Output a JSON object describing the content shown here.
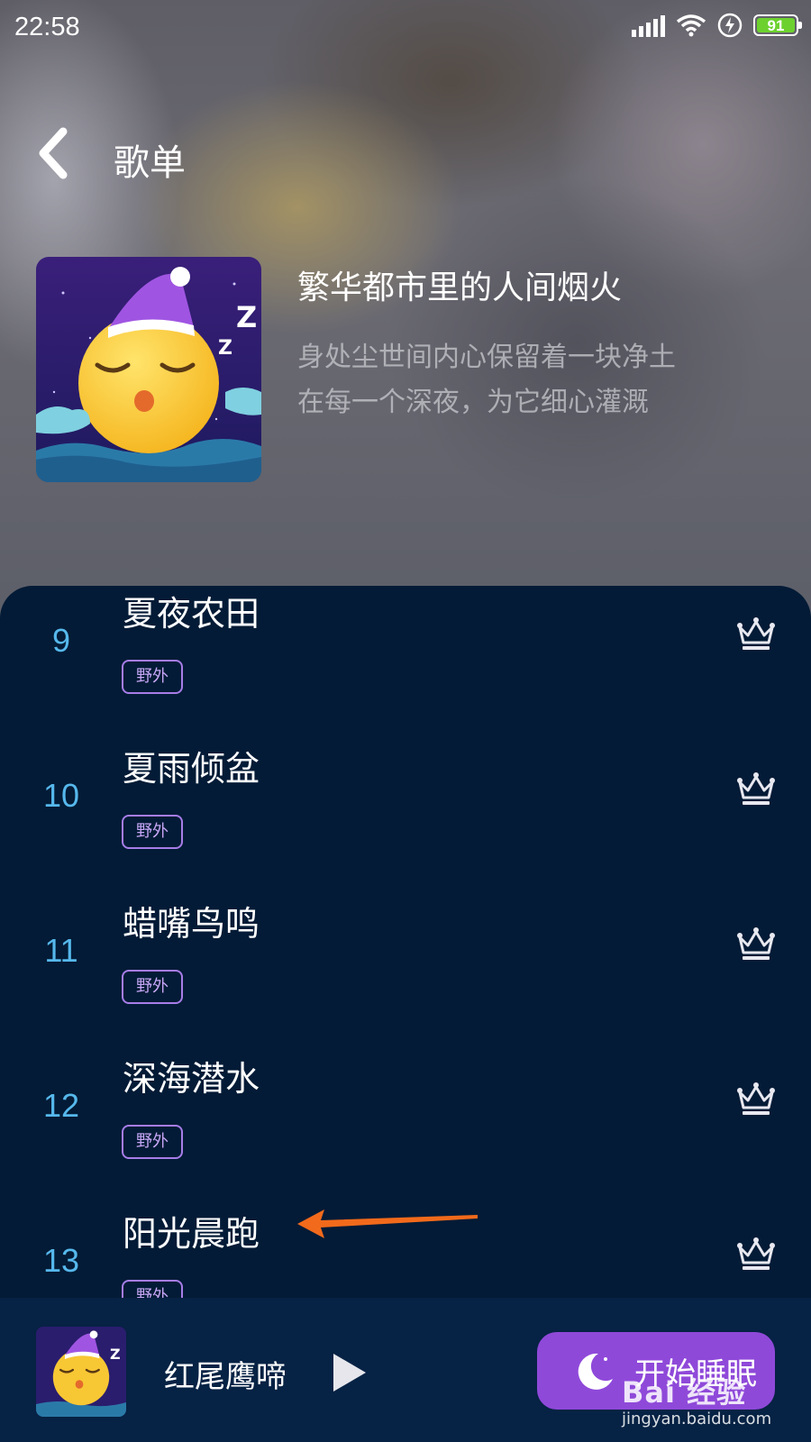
{
  "status_bar": {
    "time": "22:58",
    "battery": "91"
  },
  "header": {
    "title": "歌单"
  },
  "playlist": {
    "name": "繁华都市里的人间烟火",
    "description_lines": [
      "身处尘世间内心保留着一块净土",
      "在每一个深夜，为它细心灌溉"
    ]
  },
  "tracks": [
    {
      "number": "9",
      "title": "夏夜农田",
      "tag": "野外"
    },
    {
      "number": "10",
      "title": "夏雨倾盆",
      "tag": "野外"
    },
    {
      "number": "11",
      "title": "蜡嘴鸟鸣",
      "tag": "野外"
    },
    {
      "number": "12",
      "title": "深海潜水",
      "tag": "野外"
    },
    {
      "number": "13",
      "title": "阳光晨跑",
      "tag": "野外"
    }
  ],
  "player": {
    "now_playing": "红尾鹰啼",
    "sleep_button_label": "开始睡眠"
  },
  "watermark": {
    "logo": "Bai 经验",
    "url": "jingyan.baidu.com"
  },
  "colors": {
    "list_bg": "#031b36",
    "number": "#56b8ec",
    "tag_border": "#a77de8",
    "sleep_button": "#8f49d9",
    "arrow": "#f26a1b"
  },
  "icons": [
    "back-arrow-icon",
    "crown-icon",
    "play-icon",
    "moon-icon",
    "signal-icon",
    "wifi-icon",
    "charging-icon",
    "battery-icon"
  ]
}
